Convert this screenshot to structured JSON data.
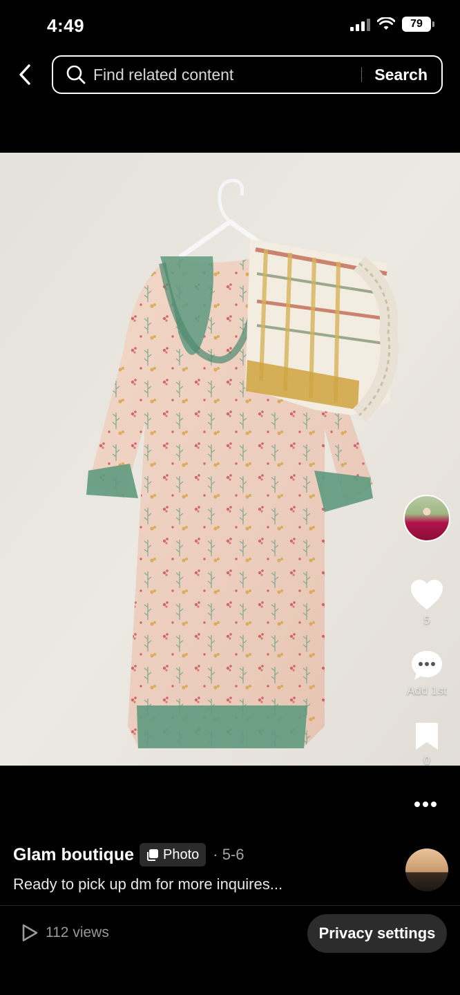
{
  "status_bar": {
    "time": "4:49",
    "battery": "79"
  },
  "header": {
    "back_icon": "chevron-left-icon",
    "search_placeholder": "Find related content",
    "search_button": "Search"
  },
  "post": {
    "image_description_icon": "photo",
    "author": "Glam boutique",
    "badge_label": "Photo",
    "date": "· 5-6",
    "caption": "Ready to pick up dm for more inquires...",
    "views": "112 views"
  },
  "actions": {
    "likes": "5",
    "comments": "Add 1st",
    "saves": "0"
  },
  "footer": {
    "privacy_button": "Privacy settings"
  },
  "colors": {
    "background": "#000000",
    "wall": "#e8e4de",
    "badge_bg": "#2b2b2b",
    "button_bg": "#2c2c2c"
  }
}
